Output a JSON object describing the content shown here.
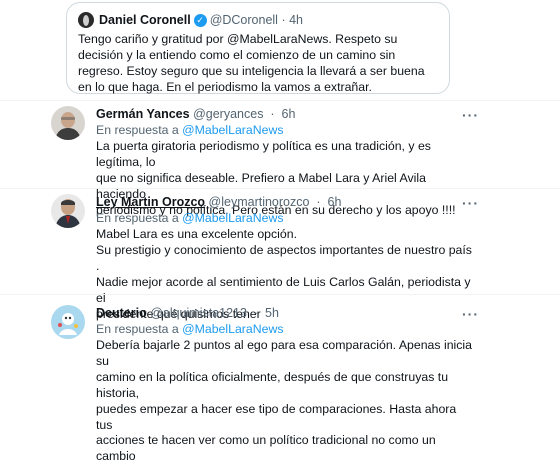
{
  "quoted": {
    "name": "Daniel Coronell",
    "handle": "@DCoronell",
    "time": "4h",
    "text": "Tengo cariño y gratitud por @MabelLaraNews. Respeto su decisión y la entiendo como el comienzo de un camino sin regreso. Estoy seguro que su inteligencia la llevará a ser buena en lo que haga. En el periodismo la vamos a extrañar."
  },
  "reply_prefix": "En respuesta a",
  "reply_to": "@MabelLaraNews",
  "more_label": "···",
  "verified_glyph": "✓",
  "tweets": [
    {
      "name": "Germán Yances",
      "handle": "@geryances",
      "time": "6h",
      "lines": [
        "La puerta giratoria periodismo y política es una tradición, y es legítima, lo",
        "que no significa deseable. Prefiero a Mabel Lara y Ariel Avila haciendo",
        "periodismo y no política. Pero están en su derecho y los apoyo !!!!"
      ]
    },
    {
      "name": "Ley Martin Orozco",
      "handle": "@leymartinorozco",
      "time": "6h",
      "lines": [
        "Mabel Lara es una excelente opción.",
        "Su prestigio y conocimiento de aspectos importantes de nuestro país .",
        "Nadie mejor acorde al sentimiento de Luis Carlos Galán, periodista y el",
        "presidente qué quisimos tener"
      ]
    },
    {
      "name": "Deuterio",
      "handle": "@alquimista1213",
      "time": "5h",
      "lines": [
        "Debería bajarle 2 puntos al ego para esa comparación. Apenas inicia su",
        "camino en la política oficialmente, después de que construyas tu historia,",
        "puedes empezar a hacer ese tipo de comparaciones. Hasta ahora tus",
        "acciones te hacen ver como un político tradicional no como un cambio"
      ]
    }
  ]
}
